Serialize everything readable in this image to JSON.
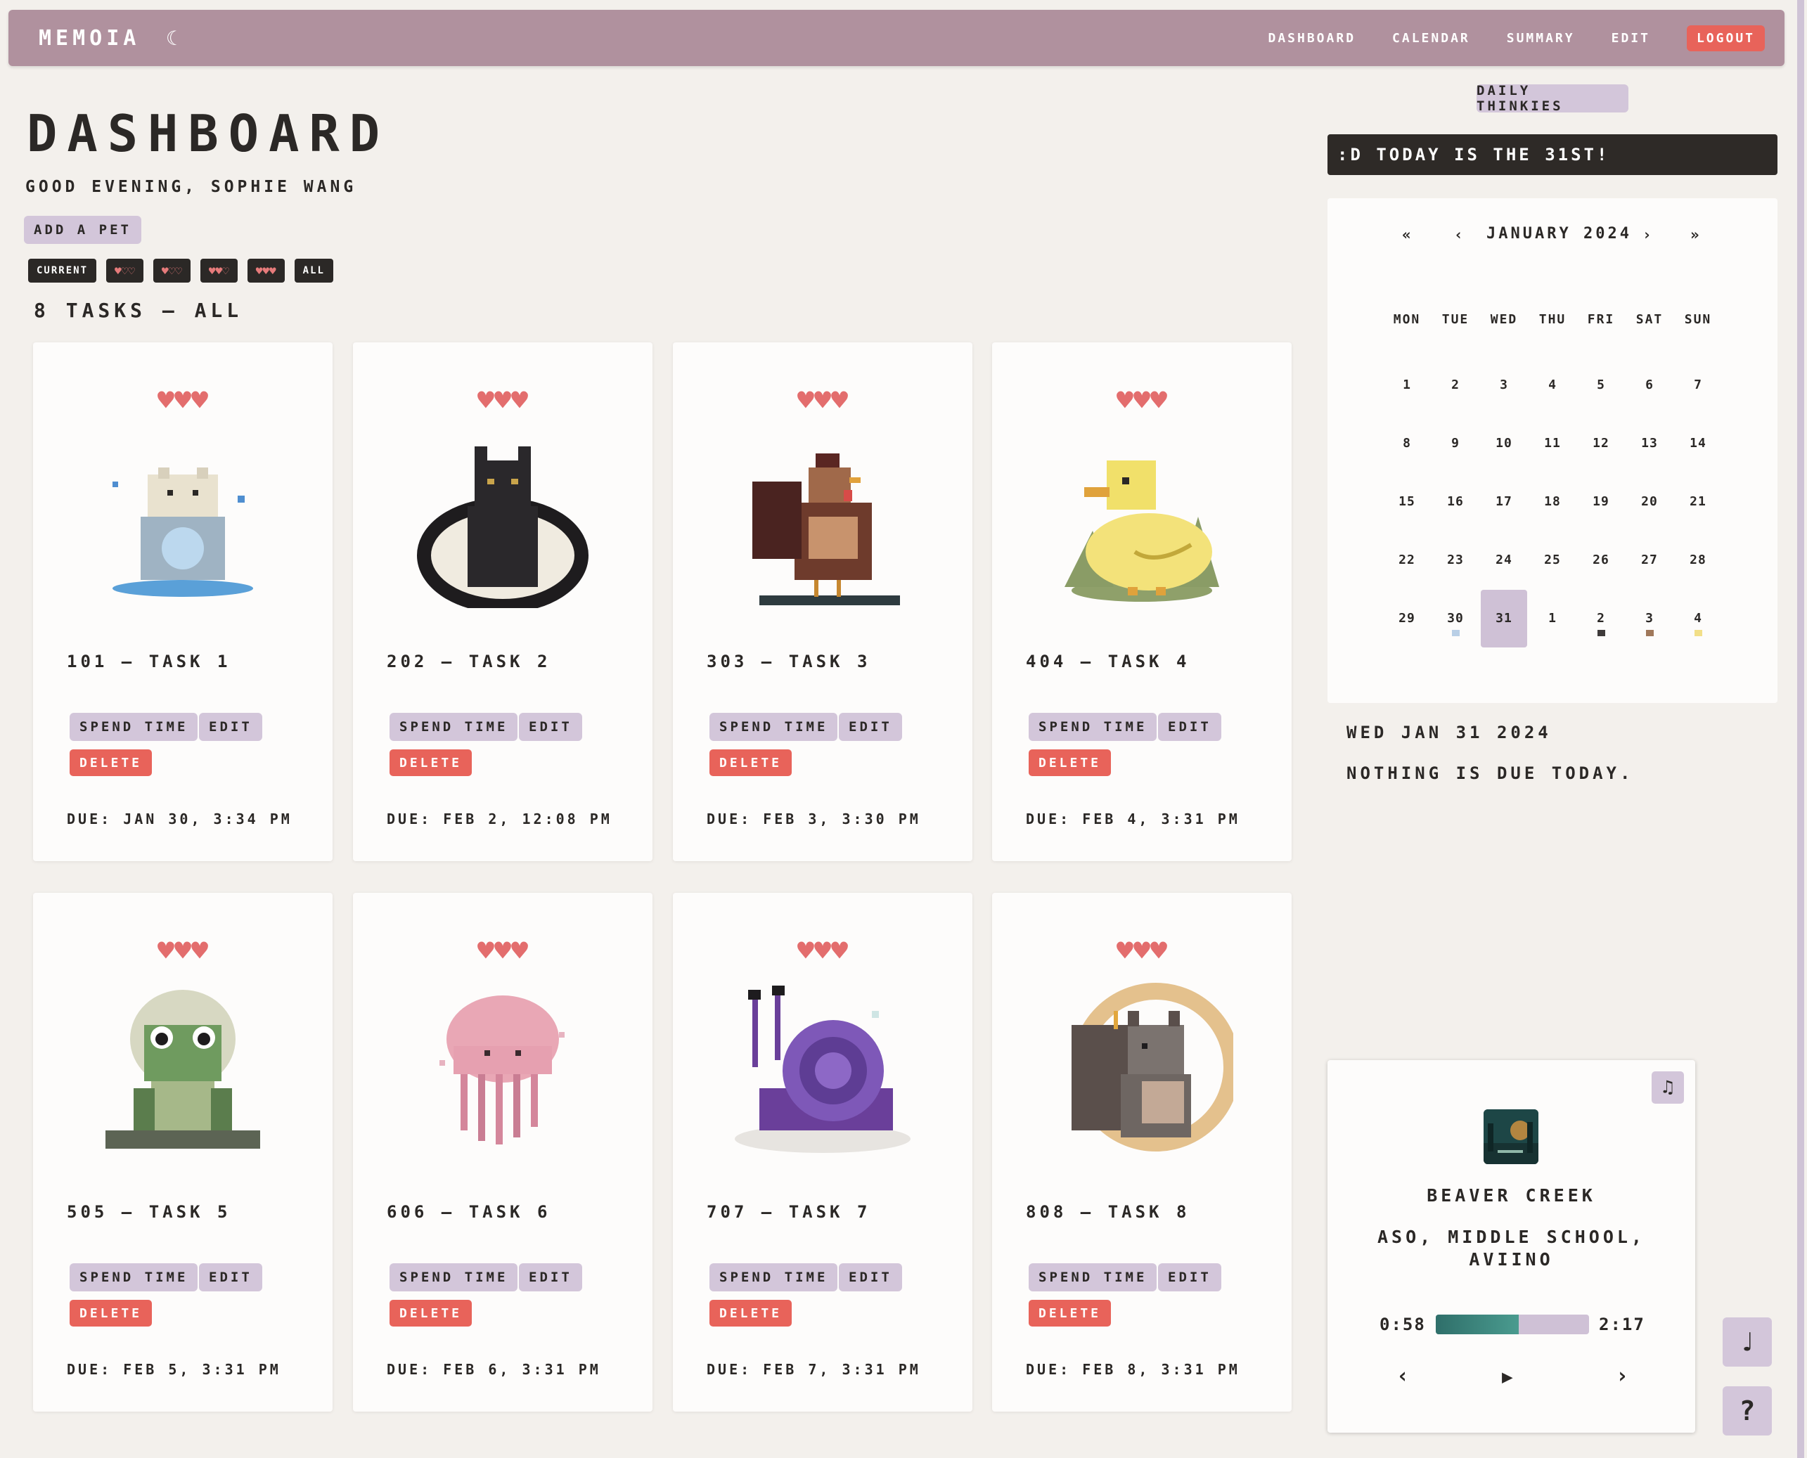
{
  "header": {
    "brand": "MEMOIA",
    "theme_icon": "☾",
    "nav": [
      "DASHBOARD",
      "CALENDAR",
      "SUMMARY",
      "EDIT"
    ],
    "logout": "LOGOUT"
  },
  "page": {
    "title": "DASHBOARD",
    "greeting": "GOOD EVENING, SOPHIE WANG",
    "add_pet": "ADD A PET",
    "filters": {
      "current": "CURRENT",
      "all": "ALL"
    },
    "task_count": "8 TASKS — ALL"
  },
  "tasks": [
    {
      "title": "101 — TASK 1",
      "due": "DUE: JAN 30, 3:34 PM",
      "pet": "polar-bear",
      "hearts": 3
    },
    {
      "title": "202 — TASK 2",
      "due": "DUE: FEB 2, 12:08 PM",
      "pet": "black-cat",
      "hearts": 3
    },
    {
      "title": "303 — TASK 3",
      "due": "DUE: FEB 3, 3:30 PM",
      "pet": "rooster",
      "hearts": 3
    },
    {
      "title": "404 — TASK 4",
      "due": "DUE: FEB 4, 3:31 PM",
      "pet": "duck",
      "hearts": 3
    },
    {
      "title": "505 — TASK 5",
      "due": "DUE: FEB 5, 3:31 PM",
      "pet": "frog",
      "hearts": 3
    },
    {
      "title": "606 — TASK 6",
      "due": "DUE: FEB 6, 3:31 PM",
      "pet": "jellyfish",
      "hearts": 3
    },
    {
      "title": "707 — TASK 7",
      "due": "DUE: FEB 7, 3:31 PM",
      "pet": "snail",
      "hearts": 3
    },
    {
      "title": "808 — TASK 8",
      "due": "DUE: FEB 8, 3:31 PM",
      "pet": "squirrel",
      "hearts": 3
    }
  ],
  "card_buttons": {
    "spend": "SPEND TIME",
    "edit": "EDIT",
    "delete": "DELETE"
  },
  "sidebar": {
    "daily_label": "DAILY THINKIES",
    "today_banner": ":D TODAY IS THE 31ST!",
    "calendar": {
      "month": "JANUARY 2024",
      "nav": {
        "prev_year": "«",
        "prev": "‹",
        "next": "›",
        "next_year": "»"
      },
      "weekdays": [
        "MON",
        "TUE",
        "WED",
        "THU",
        "FRI",
        "SAT",
        "SUN"
      ],
      "weeks": [
        [
          "1",
          "2",
          "3",
          "4",
          "5",
          "6",
          "7"
        ],
        [
          "8",
          "9",
          "10",
          "11",
          "12",
          "13",
          "14"
        ],
        [
          "15",
          "16",
          "17",
          "18",
          "19",
          "20",
          "21"
        ],
        [
          "22",
          "23",
          "24",
          "25",
          "26",
          "27",
          "28"
        ],
        [
          "29",
          "30",
          "31",
          "1",
          "2",
          "3",
          "4"
        ]
      ],
      "selected": "31",
      "dots": {
        "30": "#b9cfe6",
        "2": "#3e3a3a",
        "3": "#a0785a",
        "4": "#f2df88"
      }
    },
    "selected_date": "WED JAN 31 2024",
    "nothing_due": "NOTHING IS DUE TODAY."
  },
  "player": {
    "song": "BEAVER CREEK",
    "artist": "ASO, MIDDLE SCHOOL, AVIINO",
    "current_time": "0:58",
    "total_time": "2:17",
    "progress": 0.54,
    "icons": {
      "note": "♫",
      "prev": "‹",
      "play": "▶",
      "next": "›"
    }
  },
  "side_buttons": {
    "music": "♩",
    "help": "?"
  },
  "colors": {
    "accent": "#b0919e",
    "lavender": "#d3c6da",
    "danger": "#e8635a",
    "dark": "#2b2826"
  }
}
